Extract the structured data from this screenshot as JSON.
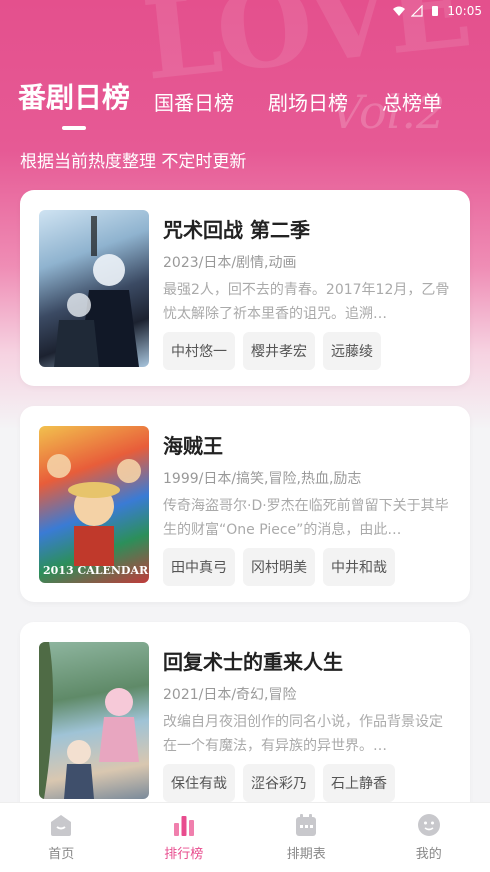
{
  "status_bar": {
    "time": "10:05"
  },
  "hero": {
    "deco_text": "LOVE",
    "script_text": "Vol.2"
  },
  "tabs": [
    {
      "label": "番剧日榜",
      "active": true
    },
    {
      "label": "国番日榜",
      "active": false
    },
    {
      "label": "剧场日榜",
      "active": false
    },
    {
      "label": "总榜单",
      "active": false
    }
  ],
  "subtitle": "根据当前热度整理 不定时更新",
  "items": [
    {
      "title": "咒术回战 第二季",
      "meta": "2023/日本/剧情,动画",
      "desc": "最强2人，回不去的青春。2017年12月，乙骨忧太解除了祈本里香的诅咒。追溯…",
      "tags": [
        "中村悠一",
        "樱井孝宏",
        "远藤绫"
      ]
    },
    {
      "title": "海贼王",
      "meta": "1999/日本/搞笑,冒险,热血,励志",
      "desc": "传奇海盗哥尔·D·罗杰在临死前曾留下关于其毕生的财富“One Piece”的消息，由此…",
      "tags": [
        "田中真弓",
        "冈村明美",
        "中井和哉"
      ],
      "poster_text": "2013 CALENDAR"
    },
    {
      "title": "回复术士的重来人生",
      "meta": "2021/日本/奇幻,冒险",
      "desc": "改编自月夜泪创作的同名小说，作品背景设定在一个有魔法，有异族的异世界。…",
      "tags": [
        "保住有哉",
        "涩谷彩乃",
        "石上静香"
      ]
    }
  ],
  "nav": [
    {
      "label": "首页",
      "icon": "home-icon",
      "active": false
    },
    {
      "label": "排行榜",
      "icon": "ranking-icon",
      "active": true
    },
    {
      "label": "排期表",
      "icon": "calendar-icon",
      "active": false
    },
    {
      "label": "我的",
      "icon": "profile-icon",
      "active": false
    }
  ],
  "colors": {
    "accent": "#e84c8e",
    "hero": "#e4508d"
  }
}
